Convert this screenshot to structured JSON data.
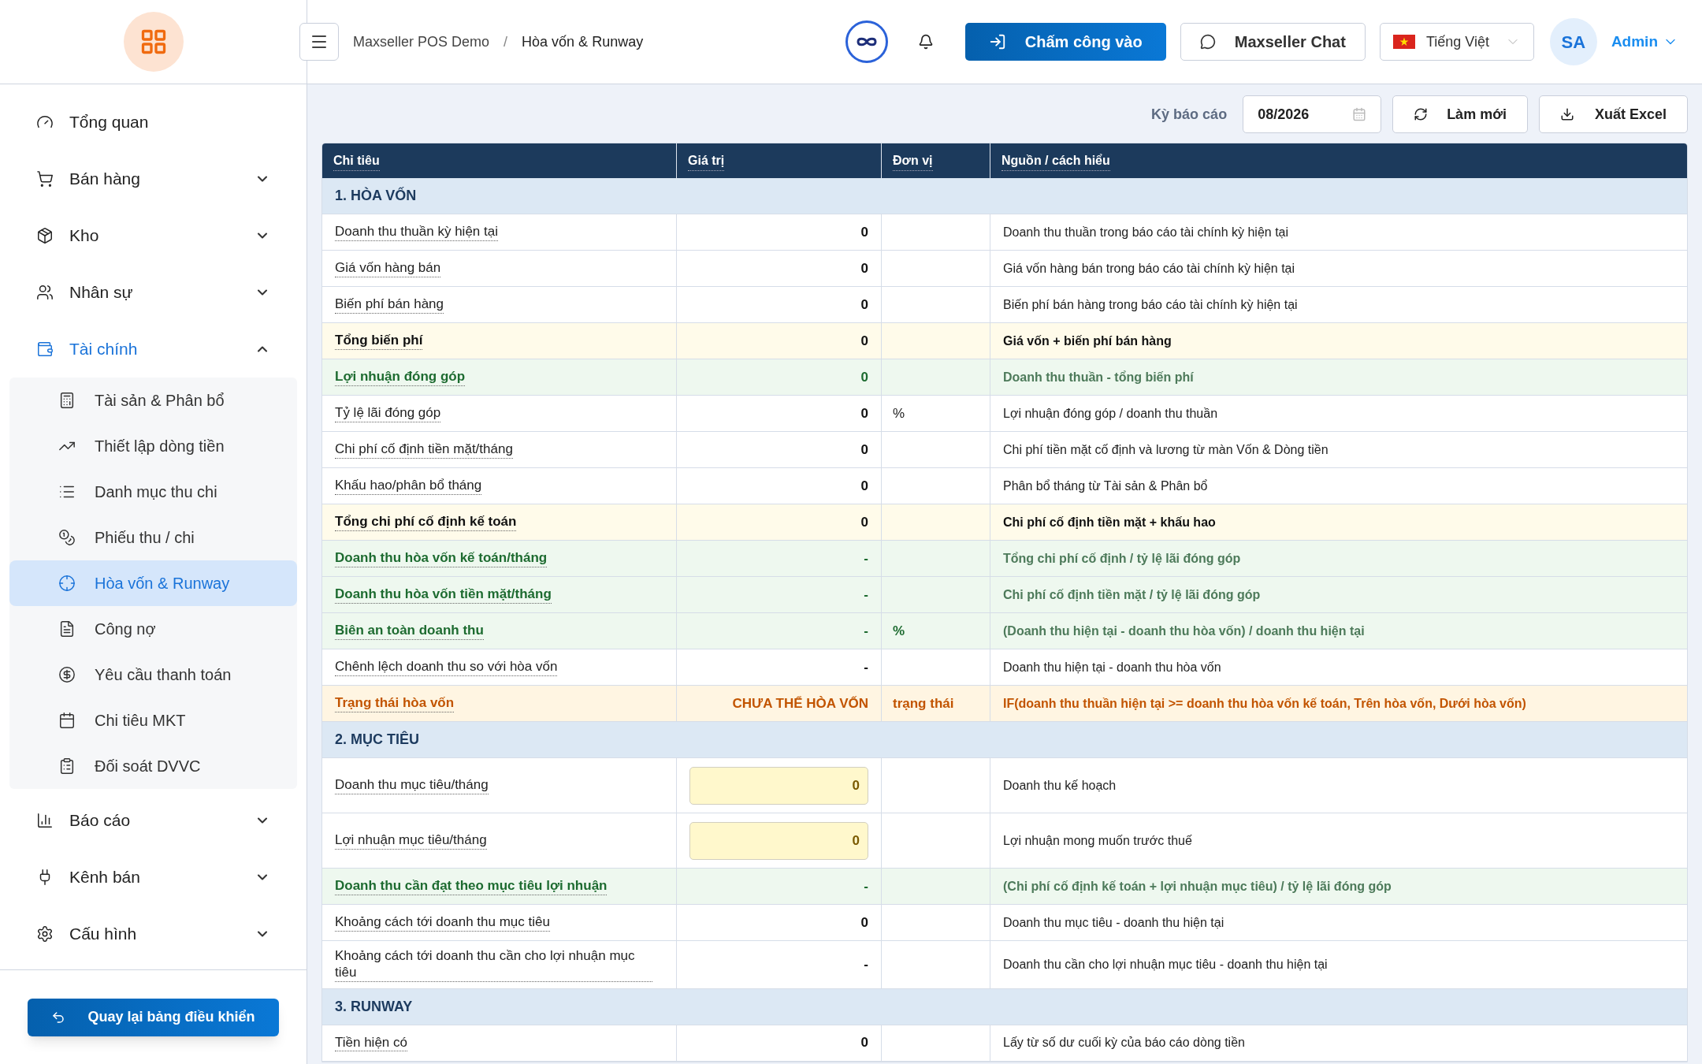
{
  "header": {
    "breadcrumb": [
      "Maxseller POS Demo",
      "Hòa vốn & Runway"
    ],
    "breadcrumb_separator": "/",
    "checkin_button": "Chấm công vào",
    "chat_button": "Maxseller Chat",
    "language": "Tiếng Việt",
    "avatar": "SA",
    "user": "Admin"
  },
  "sidebar": {
    "items": [
      {
        "label": "Tổng quan"
      },
      {
        "label": "Bán hàng",
        "expanded": false
      },
      {
        "label": "Kho",
        "expanded": false
      },
      {
        "label": "Nhân sự",
        "expanded": false
      },
      {
        "label": "Tài chính",
        "expanded": true,
        "children": [
          {
            "label": "Tài sản & Phân bổ",
            "selected": false
          },
          {
            "label": "Thiết lập dòng tiền",
            "selected": false
          },
          {
            "label": "Danh mục thu chi",
            "selected": false
          },
          {
            "label": "Phiếu thu / chi",
            "selected": false
          },
          {
            "label": "Hòa vốn & Runway",
            "selected": true
          },
          {
            "label": "Công nợ",
            "selected": false
          },
          {
            "label": "Yêu cầu thanh toán",
            "selected": false
          },
          {
            "label": "Chi tiêu MKT",
            "selected": false
          },
          {
            "label": "Đối soát DVVC",
            "selected": false
          }
        ]
      },
      {
        "label": "Báo cáo",
        "expanded": false
      },
      {
        "label": "Kênh bán",
        "expanded": false
      },
      {
        "label": "Cấu hình",
        "expanded": false
      }
    ],
    "back_button": "Quay lại bảng điều khiển"
  },
  "toolbar": {
    "period_label": "Kỳ báo cáo",
    "period_value": "08/2026",
    "refresh_button": "Làm mới",
    "export_button": "Xuất Excel"
  },
  "table": {
    "columns": [
      "Chỉ tiêu",
      "Giá trị",
      "Đơn vị",
      "Nguồn / cách hiểu"
    ],
    "rows": [
      {
        "kind": "section",
        "label": "1. HÒA VỐN"
      },
      {
        "kind": "normal",
        "label": "Doanh thu thuần kỳ hiện tại",
        "value": "0",
        "unit": "",
        "note": "Doanh thu thuần trong báo cáo tài chính kỳ hiện tại"
      },
      {
        "kind": "normal",
        "label": "Giá vốn hàng bán",
        "value": "0",
        "unit": "",
        "note": "Giá vốn hàng bán trong báo cáo tài chính kỳ hiện tại"
      },
      {
        "kind": "normal",
        "label": "Biến phí bán hàng",
        "value": "0",
        "unit": "",
        "note": "Biến phí bán hàng trong báo cáo tài chính kỳ hiện tại"
      },
      {
        "kind": "total",
        "label": "Tổng biến phí",
        "value": "0",
        "unit": "",
        "note": "Giá vốn + biến phí bán hàng"
      },
      {
        "kind": "result",
        "label": "Lợi nhuận đóng góp",
        "value": "0",
        "unit": "",
        "note": "Doanh thu thuần - tổng biến phí"
      },
      {
        "kind": "normal",
        "label": "Tỷ lệ lãi đóng góp",
        "value": "0",
        "unit": "%",
        "note": "Lợi nhuận đóng góp / doanh thu thuần"
      },
      {
        "kind": "normal",
        "label": "Chi phí cố định tiền mặt/tháng",
        "value": "0",
        "unit": "",
        "note": "Chi phí tiền mặt cố định và lương từ màn Vốn & Dòng tiền"
      },
      {
        "kind": "normal",
        "label": "Khấu hao/phân bổ tháng",
        "value": "0",
        "unit": "",
        "note": "Phân bổ tháng từ Tài sản & Phân bổ"
      },
      {
        "kind": "total",
        "label": "Tổng chi phí cố định kế toán",
        "value": "0",
        "unit": "",
        "note": "Chi phí cố định tiền mặt + khấu hao"
      },
      {
        "kind": "result",
        "label": "Doanh thu hòa vốn kế toán/tháng",
        "value": "-",
        "unit": "",
        "note": "Tổng chi phí cố định / tỷ lệ lãi đóng góp"
      },
      {
        "kind": "result",
        "label": "Doanh thu hòa vốn tiền mặt/tháng",
        "value": "-",
        "unit": "",
        "note": "Chi phí cố định tiền mặt / tỷ lệ lãi đóng góp"
      },
      {
        "kind": "result",
        "label": "Biên an toàn doanh thu",
        "value": "-",
        "unit": "%",
        "note": "(Doanh thu hiện tại - doanh thu hòa vốn) / doanh thu hiện tại"
      },
      {
        "kind": "normal",
        "label": "Chênh lệch doanh thu so với hòa vốn",
        "value": "-",
        "unit": "",
        "note": "Doanh thu hiện tại - doanh thu hòa vốn"
      },
      {
        "kind": "status",
        "label": "Trạng thái hòa vốn",
        "value": "CHƯA THỂ HÒA VỐN",
        "unit": "trạng thái",
        "note": "IF(doanh thu thuần hiện tại >= doanh thu hòa vốn kế toán, Trên hòa vốn, Dưới hòa vốn)"
      },
      {
        "kind": "section",
        "label": "2. MỤC TIÊU"
      },
      {
        "kind": "input",
        "label": "Doanh thu mục tiêu/tháng",
        "value": "0",
        "unit": "",
        "note": "Doanh thu kế hoạch"
      },
      {
        "kind": "input",
        "label": "Lợi nhuận mục tiêu/tháng",
        "value": "0",
        "unit": "",
        "note": "Lợi nhuận mong muốn trước thuế"
      },
      {
        "kind": "result",
        "label": "Doanh thu cần đạt theo mục tiêu lợi nhuận",
        "value": "-",
        "unit": "",
        "note": "(Chi phí cố định kế toán + lợi nhuận mục tiêu) / tỷ lệ lãi đóng góp"
      },
      {
        "kind": "normal",
        "label": "Khoảng cách tới doanh thu mục tiêu",
        "value": "0",
        "unit": "",
        "note": "Doanh thu mục tiêu - doanh thu hiện tại"
      },
      {
        "kind": "normal",
        "label": "Khoảng cách tới doanh thu cần cho lợi nhuận mục tiêu",
        "value": "-",
        "unit": "",
        "note": "Doanh thu cần cho lợi nhuận mục tiêu - doanh thu hiện tại"
      },
      {
        "kind": "section",
        "label": "3. RUNWAY"
      },
      {
        "kind": "normal",
        "label": "Tiền hiện có",
        "value": "0",
        "unit": "",
        "note": "Lấy từ số dư cuối kỳ của báo cáo dòng tiền"
      }
    ]
  }
}
